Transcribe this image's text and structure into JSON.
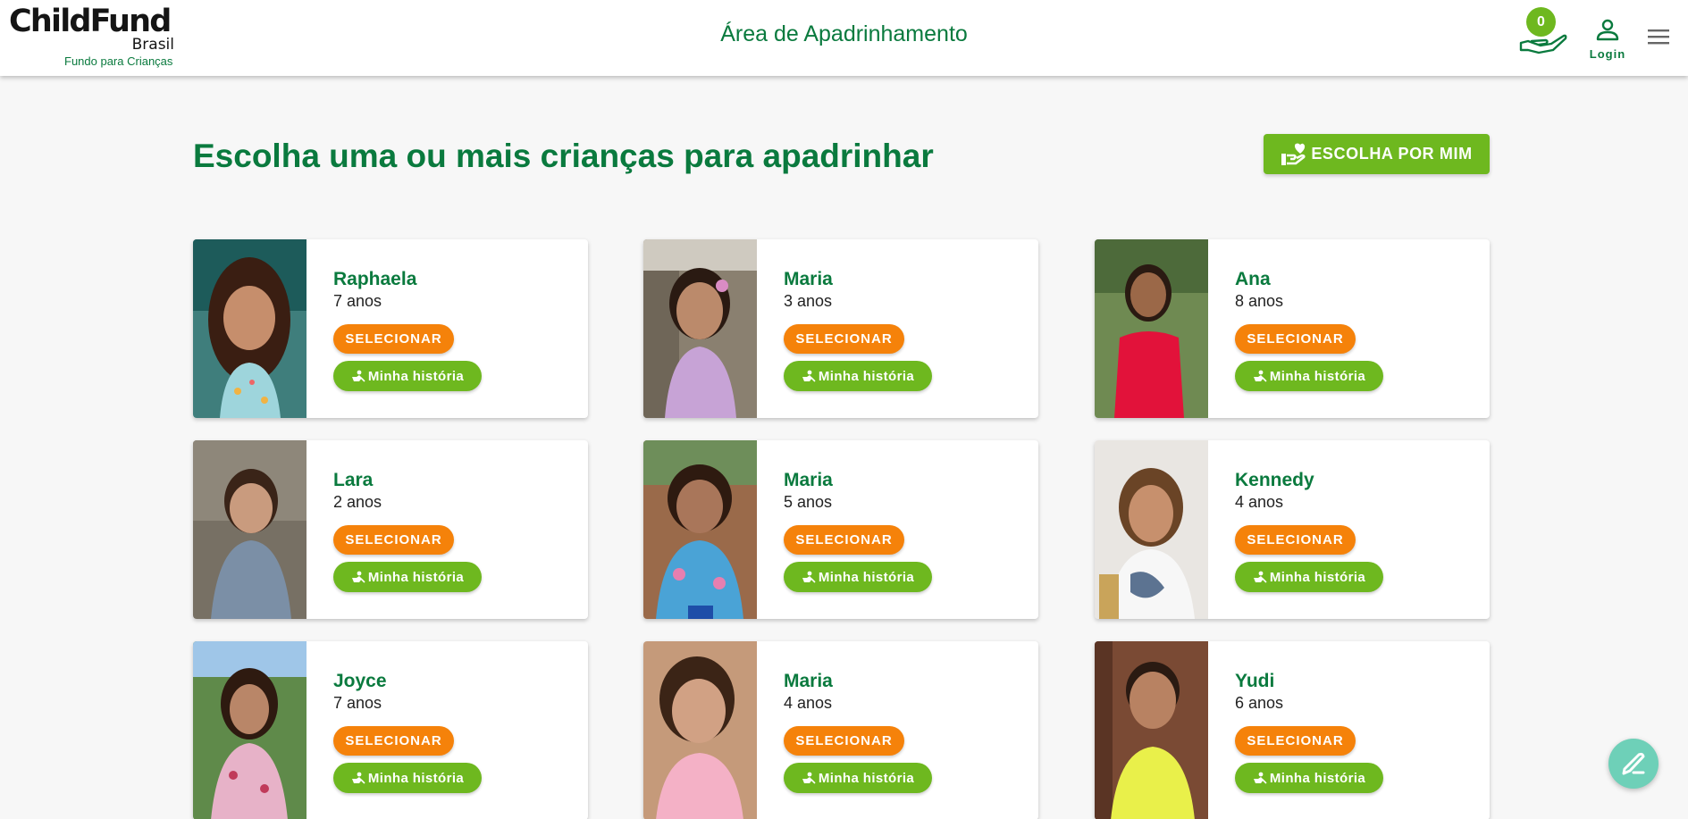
{
  "brand": {
    "name": "ChildFund",
    "country": "Brasil",
    "tagline": "Fundo para Crianças",
    "green": "#0a7a3e",
    "light_green": "#6eb81f",
    "orange": "#f5820a"
  },
  "header": {
    "title": "Área de Apadrinhamento",
    "cart_count": "0",
    "login_label": "Login",
    "icons": [
      "cart-hand-icon",
      "user-icon",
      "hamburger-menu-icon"
    ]
  },
  "main": {
    "title": "Escolha uma ou mais crianças para apadrinhar",
    "choose_for_me_label": "ESCOLHA POR MIM"
  },
  "children": [
    {
      "name": "Raphaela",
      "age": "7 anos",
      "select_label": "SELECIONAR",
      "story_label": "Minha história"
    },
    {
      "name": "Maria",
      "age": "3 anos",
      "select_label": "SELECIONAR",
      "story_label": "Minha história"
    },
    {
      "name": "Ana",
      "age": "8 anos",
      "select_label": "SELECIONAR",
      "story_label": "Minha história"
    },
    {
      "name": "Lara",
      "age": "2 anos",
      "select_label": "SELECIONAR",
      "story_label": "Minha história"
    },
    {
      "name": "Maria",
      "age": "5 anos",
      "select_label": "SELECIONAR",
      "story_label": "Minha história"
    },
    {
      "name": "Kennedy",
      "age": "4 anos",
      "select_label": "SELECIONAR",
      "story_label": "Minha história"
    },
    {
      "name": "Joyce",
      "age": "7 anos",
      "select_label": "SELECIONAR",
      "story_label": "Minha história"
    },
    {
      "name": "Maria",
      "age": "4 anos",
      "select_label": "SELECIONAR",
      "story_label": "Minha história"
    },
    {
      "name": "Yudi",
      "age": "6 anos",
      "select_label": "SELECIONAR",
      "story_label": "Minha história"
    }
  ]
}
